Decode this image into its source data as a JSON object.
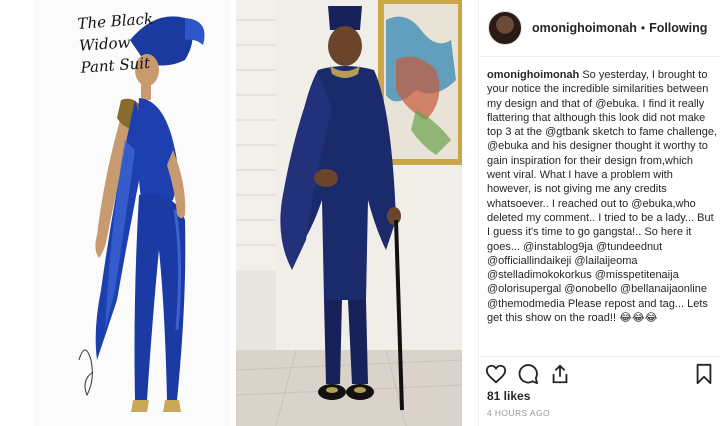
{
  "post": {
    "image": {
      "sketch_title": "The Black Widow Pant Suit"
    },
    "header": {
      "username": "omonighoimonah",
      "separator": "•",
      "follow_status": "Following"
    },
    "caption": {
      "username": "omonighoimonah",
      "text": " So yesterday, I brought to your notice the incredible similarities between my design and that of @ebuka. I find it really flattering that although this look did not make top 3 at the @gtbank sketch to fame challenge, @ebuka and his designer thought it worthy to gain inspiration for their design from,which went viral. What I have a problem with however, is not giving me any credits whatsoever.. I reached out to @ebuka,who deleted my comment.. I tried to be a lady... But I guess it's time to go gangsta!.. So here it goes... @instablog9ja @tundeednut @officiallindaikeji @lailaijeoma @stelladimokokorkus @misspetitenaija @olorisupergal @onobello @bellanaijaonline @themodmedia Please repost and tag... Lets get this show on the road!! 😂😂😂"
    },
    "actions": {
      "like_icon": "heart-icon",
      "comment_icon": "comment-icon",
      "share_icon": "share-icon",
      "save_icon": "bookmark-icon"
    },
    "likes": "81 likes",
    "timestamp": "4 HOURS AGO"
  },
  "colors": {
    "text": "#262626",
    "muted": "#999999",
    "divider": "#efefef",
    "suit_blue": "#1b2a6b"
  }
}
